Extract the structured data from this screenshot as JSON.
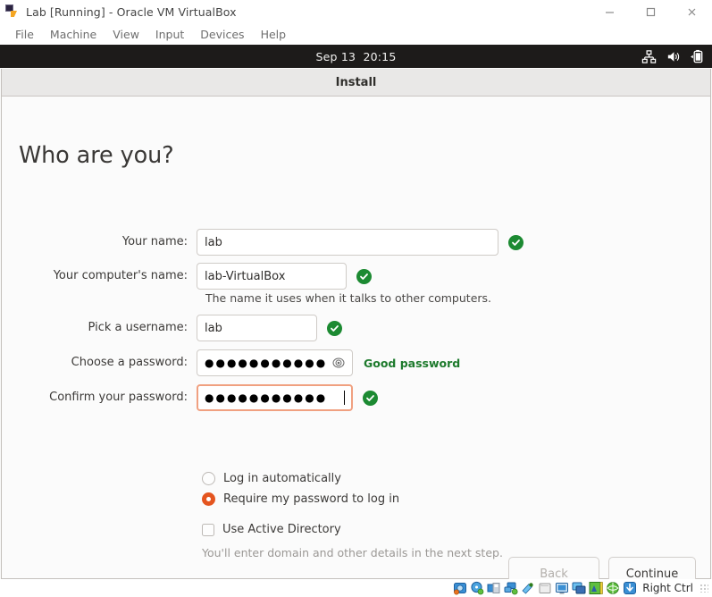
{
  "host_window": {
    "title": "Lab [Running] - Oracle VM VirtualBox",
    "app_icon": "virtualbox-icon",
    "window_controls": {
      "minimize": "minimize-icon",
      "maximize": "maximize-icon",
      "close": "close-icon"
    },
    "menubar": [
      {
        "label": "File"
      },
      {
        "label": "Machine"
      },
      {
        "label": "View"
      },
      {
        "label": "Input"
      },
      {
        "label": "Devices"
      },
      {
        "label": "Help"
      }
    ],
    "statusbar": {
      "icons": [
        "hard-disk-icon",
        "optical-disk-icon",
        "floppy-disk-icon",
        "network-icon",
        "usb-icon",
        "shared-folder-icon",
        "display-icon",
        "remote-display-icon",
        "recording-icon",
        "mouse-integration-icon",
        "keyboard-icon"
      ],
      "host_key": "Right Ctrl"
    }
  },
  "guest": {
    "panel": {
      "clock": "Sep 13  20:15",
      "indicators": [
        "network-icon",
        "volume-icon",
        "battery-icon"
      ]
    },
    "installer": {
      "window_title": "Install",
      "heading": "Who are you?",
      "fields": [
        {
          "label": "Your name:",
          "value": "lab",
          "size": "wide",
          "valid": true,
          "validation_icon": "check-circle-icon"
        },
        {
          "label": "Your computer's name:",
          "value": "lab-VirtualBox",
          "size": "mid",
          "valid": true,
          "validation_icon": "check-circle-icon",
          "hint": "The name it uses when it talks to other computers."
        },
        {
          "label": "Pick a username:",
          "value": "lab",
          "size": "small",
          "valid": true,
          "validation_icon": "check-circle-icon"
        },
        {
          "label": "Choose a password:",
          "value": "●●●●●●●●●●●",
          "size": "pw",
          "masked": true,
          "reveal_icon": "eye-icon",
          "strength": "Good password"
        },
        {
          "label": "Confirm your password:",
          "value": "●●●●●●●●●●●",
          "size": "pw",
          "masked": true,
          "focused": true,
          "valid": true,
          "validation_icon": "check-circle-icon"
        }
      ],
      "options": {
        "login_auto": {
          "label": "Log in automatically",
          "checked": false
        },
        "login_require_password": {
          "label": "Require my password to log in",
          "checked": true
        },
        "active_directory": {
          "label": "Use Active Directory",
          "checked": false
        },
        "active_directory_hint": "You'll enter domain and other details in the next step."
      },
      "buttons": {
        "back": "Back",
        "continue": "Continue"
      }
    }
  },
  "colors": {
    "accent_orange": "#e4551f",
    "valid_green": "#1c8a32",
    "panel_dark": "#1d1b1a",
    "focus_border": "#f0a080"
  }
}
